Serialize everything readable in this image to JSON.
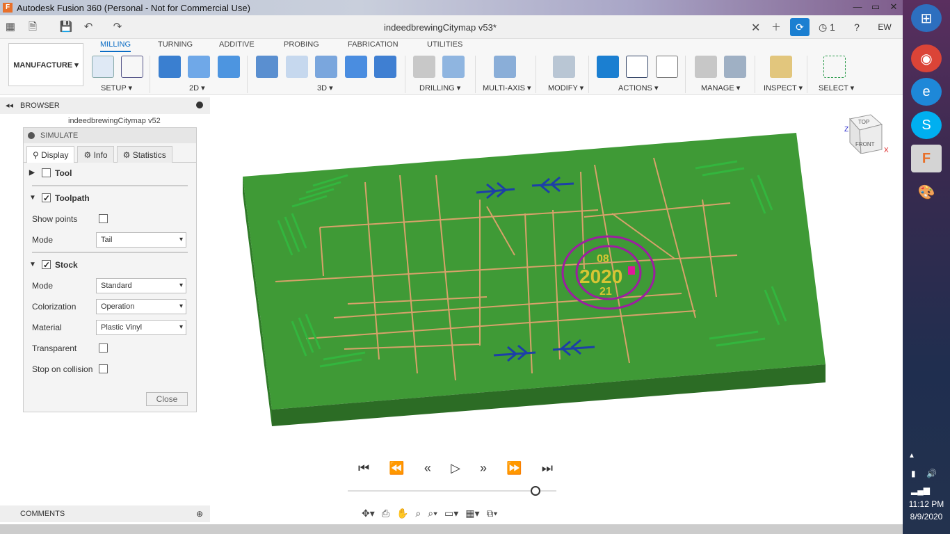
{
  "window": {
    "app_icon": "F",
    "title": "Autodesk Fusion 360 (Personal - Not for Commercial Use)",
    "minimize": "—",
    "maximize": "▭",
    "close": "✕"
  },
  "doc": {
    "title": "indeedbrewingCitymap v53*",
    "jobs": "1",
    "user": "EW"
  },
  "ribbon": {
    "workspace": "MANUFACTURE",
    "tabs": [
      "MILLING",
      "TURNING",
      "ADDITIVE",
      "PROBING",
      "FABRICATION",
      "UTILITIES"
    ],
    "groups": [
      "SETUP",
      "2D",
      "3D",
      "DRILLING",
      "MULTI-AXIS",
      "MODIFY",
      "ACTIONS",
      "MANAGE",
      "INSPECT",
      "SELECT"
    ]
  },
  "browser": {
    "title": "BROWSER",
    "root_item": "indeedbrewingCitymap v52"
  },
  "simulate": {
    "title": "SIMULATE",
    "tabs": [
      "Display",
      "Info",
      "Statistics"
    ],
    "tool_section": "Tool",
    "tool_checked": false,
    "toolpath_section": "Toolpath",
    "toolpath_checked": true,
    "show_points_label": "Show points",
    "show_points_checked": false,
    "toolpath_mode_label": "Mode",
    "toolpath_mode_value": "Tail",
    "stock_section": "Stock",
    "stock_checked": true,
    "stock_mode_label": "Mode",
    "stock_mode_value": "Standard",
    "colorization_label": "Colorization",
    "colorization_value": "Operation",
    "material_label": "Material",
    "material_value": "Plastic Vinyl",
    "transparent_label": "Transparent",
    "transparent_checked": false,
    "collision_label": "Stop on collision",
    "collision_checked": false,
    "close_label": "Close"
  },
  "viewcube": {
    "top": "TOP",
    "front": "FRONT",
    "x": "X",
    "z": "Z"
  },
  "model": {
    "line1": "08",
    "line2": "2020",
    "line3": "21",
    "colors": {
      "stock": "#3f9a36",
      "roads": "#d7a26a",
      "arrows": "#1d3fa8",
      "ring": "#9c1fa0",
      "numbers": "#d6c534"
    }
  },
  "comments": {
    "title": "COMMENTS"
  },
  "taskbar": {
    "time": "11:12 PM",
    "date": "8/9/2020"
  }
}
